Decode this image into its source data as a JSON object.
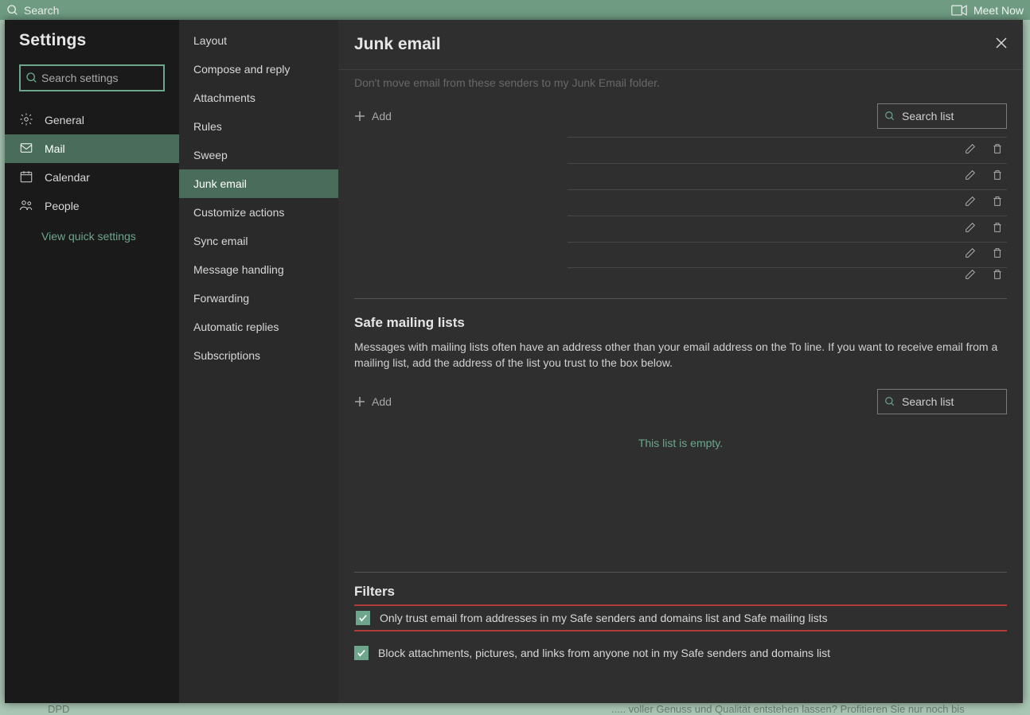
{
  "topbar": {
    "search_placeholder": "Search",
    "meet_now": "Meet Now"
  },
  "background": {
    "left_snippet": "DPD",
    "right_snippet": "..... voller Genuss und Qualität entstehen lassen? Profitieren Sie nur noch bis"
  },
  "settings": {
    "title": "Settings",
    "search_placeholder": "Search settings",
    "categories": [
      {
        "id": "general",
        "label": "General",
        "icon": "gear"
      },
      {
        "id": "mail",
        "label": "Mail",
        "icon": "mail"
      },
      {
        "id": "calendar",
        "label": "Calendar",
        "icon": "calendar"
      },
      {
        "id": "people",
        "label": "People",
        "icon": "people"
      }
    ],
    "active_category": "mail",
    "quick_link": "View quick settings"
  },
  "submenu": {
    "items": [
      "Layout",
      "Compose and reply",
      "Attachments",
      "Rules",
      "Sweep",
      "Junk email",
      "Customize actions",
      "Sync email",
      "Message handling",
      "Forwarding",
      "Automatic replies",
      "Subscriptions"
    ],
    "active": "Junk email"
  },
  "main": {
    "title": "Junk email",
    "safe_senders": {
      "partial_text": "Don't move email from these senders to my Junk Email folder.",
      "add_label": "Add",
      "search_placeholder": "Search list",
      "row_count": 5
    },
    "safe_lists": {
      "heading": "Safe mailing lists",
      "description": "Messages with mailing lists often have an address other than your email address on the To line. If you want to receive email from a mailing list, add the address of the list you trust to the box below.",
      "add_label": "Add",
      "search_placeholder": "Search list",
      "empty_message": "This list is empty."
    },
    "filters": {
      "heading": "Filters",
      "option1": {
        "label": "Only trust email from addresses in my Safe senders and domains list and Safe mailing lists",
        "checked": true,
        "highlight": true
      },
      "option2": {
        "label": "Block attachments, pictures, and links from anyone not in my Safe senders and domains list",
        "checked": true,
        "highlight": false
      }
    }
  }
}
